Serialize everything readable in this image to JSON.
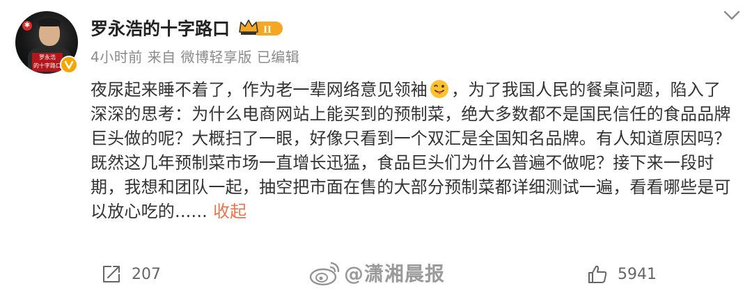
{
  "post": {
    "author_name": "罗永浩的十字路口",
    "avatar_tag_line1": "罗永浩",
    "avatar_tag_line2": "的十字路口",
    "meta": "4小时前  来自 微博轻享版 已编辑",
    "text_part1": "夜尿起来睡不着了，作为老一辈网络意见领袖",
    "text_part2": "，为了我国人民的餐桌问题，陷入了深深的思考：为什么电商网站上能买到的预制菜，绝大多数都不是国民信任的食品品牌巨头做的呢？大概扫了一眼，好像只看到一个双汇是全国知名品牌。有人知道原因吗？既然这几年预制菜市场一直增长迅猛，食品巨头们为什么普遍不做呢？接下来一段时期，我想和团队一起，抽空把市面在售的大部分预制菜都详细测试一遍，看看哪些是可以放心吃的......",
    "collapse_label": "收起",
    "badge_level": "II"
  },
  "actions": {
    "repost_count": "207",
    "like_count": "5941"
  },
  "watermark": {
    "text": "@潇湘晨报"
  },
  "icons": {
    "verified": "verified-v-icon",
    "badge": "crown-level-badge-icon",
    "emoji": "tongue-out-emoji-icon",
    "chevron": "chevron-down-icon",
    "repost": "repost-icon",
    "like": "thumbs-up-icon",
    "watermark": "weibo-logo-icon"
  },
  "colors": {
    "accent": "#eb7350",
    "verified": "#f7a500",
    "badge": "#f5a623"
  }
}
